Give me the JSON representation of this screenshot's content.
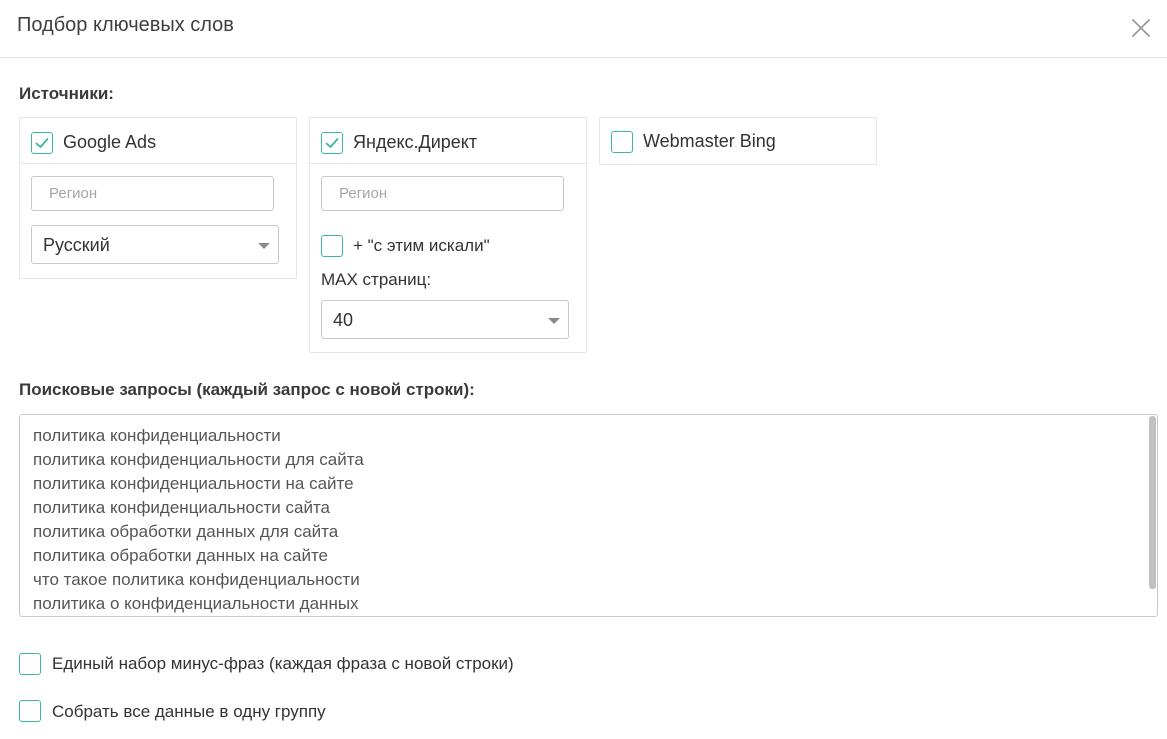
{
  "dialog": {
    "title": "Подбор ключевых слов"
  },
  "sources": {
    "label": "Источники:",
    "google": {
      "label": "Google Ads",
      "checked": true,
      "region_placeholder": "Регион",
      "language": "Русский"
    },
    "yandex": {
      "label": "Яндекс.Директ",
      "checked": true,
      "region_placeholder": "Регион",
      "also_searched_label": "+ \"с этим искали\"",
      "also_searched_checked": false,
      "max_pages_label": "MAX страниц:",
      "max_pages": "40"
    },
    "bing": {
      "label": "Webmaster Bing",
      "checked": false
    }
  },
  "queries": {
    "label": "Поисковые запросы (каждый запрос с новой строки):",
    "lines": [
      "политика конфиденциальности",
      "политика конфиденциальности для сайта",
      "политика конфиденциальности на сайте",
      "политика конфиденциальности сайта",
      "политика обработки данных для сайта",
      "политика обработки данных на сайте",
      "что такое политика конфиденциальности",
      "политика о конфиденциальности данных"
    ]
  },
  "options": {
    "minus_phrases_label": "Единый набор минус-фраз (каждая фраза с новой строки)",
    "minus_phrases_checked": false,
    "one_group_label": "Собрать все данные в одну группу",
    "one_group_checked": false
  },
  "colors": {
    "accent": "#3bb7a3",
    "border": "#c9c9c9"
  }
}
